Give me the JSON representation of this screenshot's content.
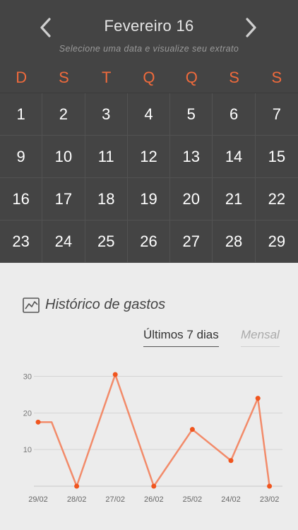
{
  "calendar": {
    "month": "Fevereiro 16",
    "subtitle": "Selecione uma data e visualize seu extrato",
    "weekdays": [
      "D",
      "S",
      "T",
      "Q",
      "Q",
      "S",
      "S"
    ],
    "days": [
      1,
      2,
      3,
      4,
      5,
      6,
      7,
      9,
      10,
      11,
      12,
      13,
      14,
      15,
      16,
      17,
      18,
      19,
      20,
      21,
      22,
      23,
      24,
      25,
      26,
      27,
      28,
      29
    ],
    "accent_color": "#ef6a3c",
    "background_color": "#444444"
  },
  "history": {
    "title": "Histórico de gastos",
    "tab_active": "Últimos 7 dias",
    "tab_inactive": "Mensal"
  },
  "chart_data": {
    "type": "line",
    "x_ticks": [
      "29/02",
      "28/02",
      "27/02",
      "26/02",
      "25/02",
      "24/02",
      "23/02"
    ],
    "y_ticks": [
      10,
      20,
      30
    ],
    "ylim": [
      0,
      33
    ],
    "points": [
      {
        "x": 0,
        "y": 17.5,
        "marker": true
      },
      {
        "x": 0.35,
        "y": 17.5,
        "marker": false
      },
      {
        "x": 1,
        "y": 0,
        "marker": true
      },
      {
        "x": 2,
        "y": 30.5,
        "marker": true
      },
      {
        "x": 3,
        "y": 0,
        "marker": true
      },
      {
        "x": 4,
        "y": 15.5,
        "marker": true
      },
      {
        "x": 5,
        "y": 7,
        "marker": true
      },
      {
        "x": 5.7,
        "y": 24,
        "marker": true
      },
      {
        "x": 6,
        "y": 0,
        "marker": true
      }
    ],
    "line_color": "#f28b6a",
    "marker_color": "#f0551e",
    "grid": true
  }
}
